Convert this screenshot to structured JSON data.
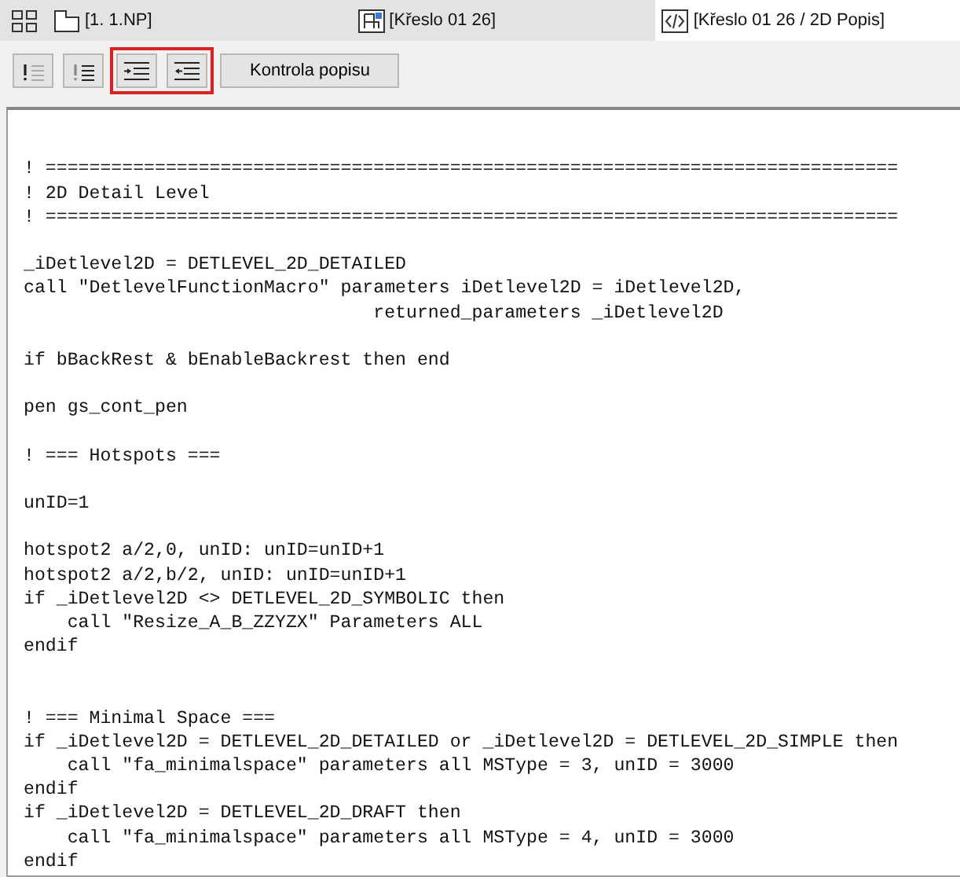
{
  "tabs": [
    {
      "label": "[1. 1.NP]",
      "kind": "floorplan",
      "selected": false
    },
    {
      "label": "[Křeslo 01 26]",
      "kind": "object",
      "selected": false
    },
    {
      "label": "[Křeslo 01 26 / 2D Popis]",
      "kind": "script",
      "selected": true
    }
  ],
  "toolbar": {
    "button_groups": [
      {
        "highlighted": false,
        "buttons": [
          {
            "kind": "comment"
          },
          {
            "kind": "uncomment"
          }
        ]
      },
      {
        "highlighted": true,
        "buttons": [
          {
            "kind": "indent"
          },
          {
            "kind": "outdent"
          }
        ]
      }
    ],
    "check_button": "Kontrola popisu"
  },
  "editor": {
    "lines": [
      {
        "kind": "blank"
      },
      {
        "kind": "blank"
      },
      {
        "kind": "code",
        "text": "! =============================================================================="
      },
      {
        "kind": "code",
        "text": "! 2D Detail Level"
      },
      {
        "kind": "code",
        "text": "! =============================================================================="
      },
      {
        "kind": "blank"
      },
      {
        "kind": "code",
        "text": "_iDetlevel2D = DETLEVEL_2D_DETAILED"
      },
      {
        "kind": "code",
        "text": "call \"DetlevelFunctionMacro\" parameters iDetlevel2D = iDetlevel2D,"
      },
      {
        "kind": "code",
        "text": "                                returned_parameters _iDetlevel2D"
      },
      {
        "kind": "blank"
      },
      {
        "kind": "code",
        "text": "if bBackRest & bEnableBackrest then end"
      },
      {
        "kind": "blank"
      },
      {
        "kind": "code",
        "text": "pen gs_cont_pen"
      },
      {
        "kind": "blank"
      },
      {
        "kind": "code",
        "text": "! === Hotspots ==="
      },
      {
        "kind": "blank"
      },
      {
        "kind": "code",
        "text": "unID=1"
      },
      {
        "kind": "blank"
      },
      {
        "kind": "code",
        "text": "hotspot2 a/2,0, unID: unID=unID+1"
      },
      {
        "kind": "code",
        "text": "hotspot2 a/2,b/2, unID: unID=unID+1"
      },
      {
        "kind": "code",
        "text": "if _iDetlevel2D <> DETLEVEL_2D_SYMBOLIC then"
      },
      {
        "kind": "code",
        "text": "    call \"Resize_A_B_ZZYZX\" Parameters ALL"
      },
      {
        "kind": "code",
        "text": "endif"
      },
      {
        "kind": "blank"
      },
      {
        "kind": "blank"
      },
      {
        "kind": "code",
        "text": "! === Minimal Space ==="
      },
      {
        "kind": "code",
        "text": "if _iDetlevel2D = DETLEVEL_2D_DETAILED or _iDetlevel2D = DETLEVEL_2D_SIMPLE then"
      },
      {
        "kind": "code",
        "text": "    call \"fa_minimalspace\" parameters all MSType = 3, unID = 3000"
      },
      {
        "kind": "code",
        "text": "endif"
      },
      {
        "kind": "code",
        "text": "if _iDetlevel2D = DETLEVEL_2D_DRAFT then"
      },
      {
        "kind": "code",
        "text": "    call \"fa_minimalspace\" parameters all MSType = 4, unID = 3000"
      },
      {
        "kind": "code",
        "text": "endif"
      }
    ]
  }
}
